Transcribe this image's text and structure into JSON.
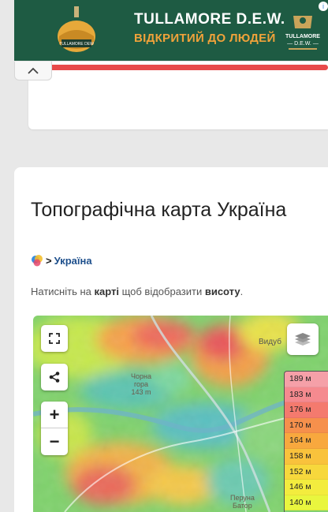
{
  "ad": {
    "brand": "TULLAMORE D.E.W.",
    "slogan": "ВІДКРИТИЙ ДО ЛЮДЕЙ",
    "crest_text": "TULLAMORE D.E.W.",
    "bottle_label": "TULLAMORE DEW",
    "adchoice": "i"
  },
  "page": {
    "title": "Топографічна карта Україна",
    "breadcrumb_link": "Україна",
    "breadcrumb_sep": ">",
    "hint_prefix": "Натисніть на ",
    "hint_bold1": "карті",
    "hint_mid": " щоб відобразити ",
    "hint_bold2": "висоту",
    "hint_suffix": "."
  },
  "map": {
    "place_label_line1": "Чорна",
    "place_label_line2": "гора",
    "place_label_line3": "143 m",
    "right_label": "Видуб",
    "bottom_label_1": "Перуна",
    "bottom_label_2": "Батор"
  },
  "legend": [
    {
      "label": "189 м",
      "color": "#f5a0a8"
    },
    {
      "label": "183 м",
      "color": "#f58a8f"
    },
    {
      "label": "176 м",
      "color": "#f47a6e"
    },
    {
      "label": "170 м",
      "color": "#f6904c"
    },
    {
      "label": "164 м",
      "color": "#f8a83e"
    },
    {
      "label": "158 м",
      "color": "#f9c23c"
    },
    {
      "label": "152 м",
      "color": "#f7d83c"
    },
    {
      "label": "146 м",
      "color": "#f3ec3e"
    },
    {
      "label": "140 м",
      "color": "#e9f63e"
    }
  ],
  "colors": {
    "ad_bg": "#1e5b43",
    "ad_slogan": "#f0a23a",
    "accent_bar": "#e84a4a",
    "link": "#1d4f8c"
  }
}
